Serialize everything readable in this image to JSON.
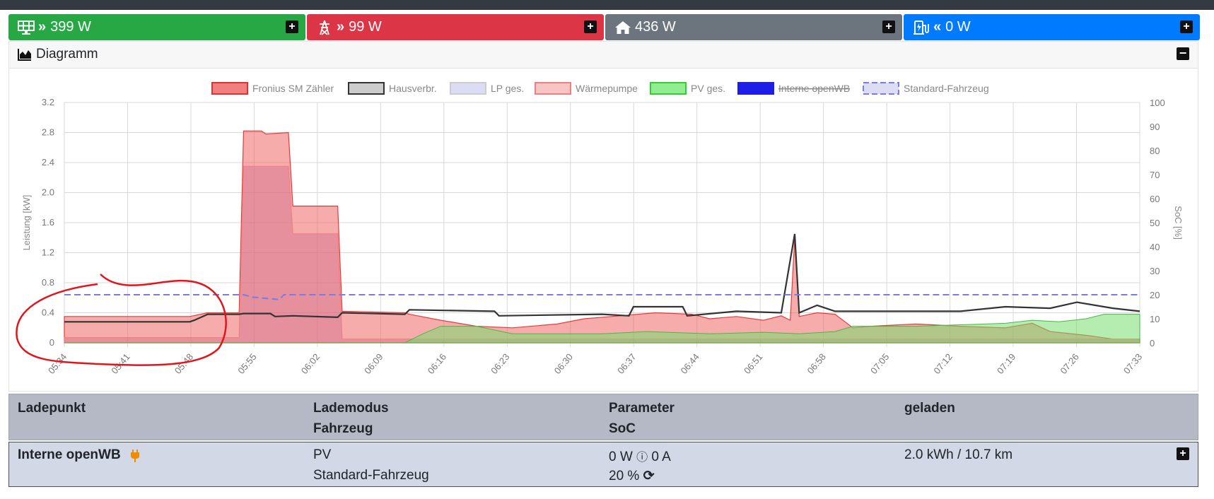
{
  "status_bar": [
    {
      "icon": "solar-panel-icon",
      "direction": "»",
      "value": "399 W",
      "color": "#28a745"
    },
    {
      "icon": "power-grid-icon",
      "direction": "»",
      "value": "99 W",
      "color": "#dc3545"
    },
    {
      "icon": "house-icon",
      "direction": "",
      "value": "436 W",
      "color": "#6c757d"
    },
    {
      "icon": "charging-station-icon",
      "direction": "«",
      "value": "0 W",
      "color": "#007bff"
    }
  ],
  "diagram": {
    "title": "Diagramm"
  },
  "chart_data": {
    "type": "area",
    "legend": [
      {
        "name": "Fronius SM Zähler",
        "color": "#f08080",
        "style": "filled",
        "hidden": false
      },
      {
        "name": "Hausverbr.",
        "color": "#333333",
        "style": "line",
        "hidden": false
      },
      {
        "name": "LP ges.",
        "color": "#dcdcf5",
        "style": "filled",
        "hidden": false
      },
      {
        "name": "Wärmepumpe",
        "color": "#f9c4c4",
        "style": "filled",
        "hidden": false
      },
      {
        "name": "PV ges.",
        "color": "#90ee90",
        "style": "filled",
        "hidden": false
      },
      {
        "name": "Interne openWB",
        "color": "#1e1ee6",
        "style": "filled",
        "hidden": true
      },
      {
        "name": "Standard-Fahrzeug",
        "color": "#7b7be6",
        "style": "dashed",
        "hidden": false
      }
    ],
    "x_ticks": [
      "05:34",
      "05:41",
      "05:48",
      "05:55",
      "06:02",
      "06:09",
      "06:16",
      "06:23",
      "06:30",
      "06:37",
      "06:44",
      "06:51",
      "06:58",
      "07:05",
      "07:12",
      "07:19",
      "07:26",
      "07:33"
    ],
    "y_left": {
      "label": "Leistung [kW]",
      "ticks": [
        "0",
        "0.4",
        "0.8",
        "1.2",
        "1.6",
        "2.0",
        "2.4",
        "2.8",
        "3.2"
      ],
      "range": [
        0,
        3.2
      ]
    },
    "y_right": {
      "label": "SoC [%]",
      "ticks": [
        "0",
        "10",
        "20",
        "30",
        "40",
        "50",
        "60",
        "70",
        "80",
        "90",
        "100"
      ],
      "range": [
        0,
        100
      ]
    },
    "x_range_minutes": [
      0,
      120
    ],
    "series": {
      "Fronius SM Zähler": [
        [
          0,
          0.35
        ],
        [
          7,
          0.35
        ],
        [
          14,
          0.35
        ],
        [
          16,
          0.4
        ],
        [
          19.5,
          0.4
        ],
        [
          20,
          2.82
        ],
        [
          22,
          2.82
        ],
        [
          22.5,
          2.78
        ],
        [
          25,
          2.8
        ],
        [
          25.5,
          1.82
        ],
        [
          30.5,
          1.82
        ],
        [
          31,
          0.42
        ],
        [
          38,
          0.4
        ],
        [
          38.5,
          0.38
        ],
        [
          42,
          0.3
        ],
        [
          46,
          0.22
        ],
        [
          50,
          0.2
        ],
        [
          55,
          0.25
        ],
        [
          58,
          0.32
        ],
        [
          62,
          0.36
        ],
        [
          66,
          0.4
        ],
        [
          70,
          0.38
        ],
        [
          72,
          0.32
        ],
        [
          75,
          0.35
        ],
        [
          78,
          0.3
        ],
        [
          80,
          0.36
        ],
        [
          81,
          0.3
        ],
        [
          81.5,
          1.4
        ],
        [
          82,
          0.35
        ],
        [
          84,
          0.4
        ],
        [
          86,
          0.38
        ],
        [
          88,
          0.2
        ],
        [
          90,
          0.22
        ],
        [
          95,
          0.25
        ],
        [
          100,
          0.22
        ],
        [
          105,
          0.2
        ],
        [
          108,
          0.26
        ],
        [
          110,
          0.15
        ],
        [
          114,
          0.1
        ],
        [
          117,
          0.05
        ],
        [
          120,
          0.05
        ]
      ],
      "Hausverbr.": [
        [
          0,
          0.28
        ],
        [
          14,
          0.28
        ],
        [
          14.5,
          0.3
        ],
        [
          16,
          0.38
        ],
        [
          19.5,
          0.38
        ],
        [
          20,
          0.39
        ],
        [
          23,
          0.39
        ],
        [
          23.5,
          0.35
        ],
        [
          25.5,
          0.36
        ],
        [
          30.5,
          0.34
        ],
        [
          31,
          0.4
        ],
        [
          38,
          0.38
        ],
        [
          38.5,
          0.44
        ],
        [
          48,
          0.42
        ],
        [
          48.5,
          0.36
        ],
        [
          60,
          0.38
        ],
        [
          63,
          0.36
        ],
        [
          63.5,
          0.48
        ],
        [
          69,
          0.48
        ],
        [
          69.5,
          0.36
        ],
        [
          75,
          0.42
        ],
        [
          80,
          0.4
        ],
        [
          81.5,
          1.45
        ],
        [
          82,
          0.4
        ],
        [
          84,
          0.5
        ],
        [
          86,
          0.42
        ],
        [
          100,
          0.42
        ],
        [
          105,
          0.48
        ],
        [
          110,
          0.46
        ],
        [
          113,
          0.54
        ],
        [
          117,
          0.46
        ],
        [
          120,
          0.42
        ]
      ],
      "Wärmepumpe": [
        [
          0,
          0.07
        ],
        [
          19.5,
          0.07
        ],
        [
          20,
          2.35
        ],
        [
          25,
          2.35
        ],
        [
          25.5,
          1.45
        ],
        [
          30.5,
          1.45
        ],
        [
          31,
          0.05
        ],
        [
          120,
          0.05
        ]
      ],
      "PV ges.": [
        [
          0,
          0
        ],
        [
          38,
          0
        ],
        [
          40,
          0.12
        ],
        [
          42,
          0.22
        ],
        [
          46,
          0.22
        ],
        [
          50,
          0.12
        ],
        [
          60,
          0.12
        ],
        [
          65,
          0.15
        ],
        [
          72,
          0.12
        ],
        [
          78,
          0.14
        ],
        [
          82,
          0.12
        ],
        [
          86,
          0.15
        ],
        [
          88,
          0.22
        ],
        [
          95,
          0.22
        ],
        [
          100,
          0.24
        ],
        [
          105,
          0.26
        ],
        [
          108,
          0.3
        ],
        [
          111,
          0.28
        ],
        [
          114,
          0.32
        ],
        [
          116,
          0.38
        ],
        [
          120,
          0.38
        ]
      ],
      "Standard-Fahrzeug": [
        [
          0,
          20
        ],
        [
          20,
          20
        ],
        [
          21,
          19
        ],
        [
          24,
          18
        ],
        [
          24.5,
          20
        ],
        [
          120,
          20
        ]
      ]
    }
  },
  "table": {
    "header": {
      "col1": "Ladepunkt",
      "col2a": "Lademodus",
      "col2b": "Fahrzeug",
      "col3a": "Parameter",
      "col3b": "SoC",
      "col4": "geladen"
    },
    "row": {
      "name": "Interne openWB",
      "mode": "PV",
      "vehicle": "Standard-Fahrzeug",
      "param_power": "0 W",
      "param_current": "0 A",
      "soc": "20 %",
      "charged": "2.0 kWh / 10.7 km"
    }
  }
}
